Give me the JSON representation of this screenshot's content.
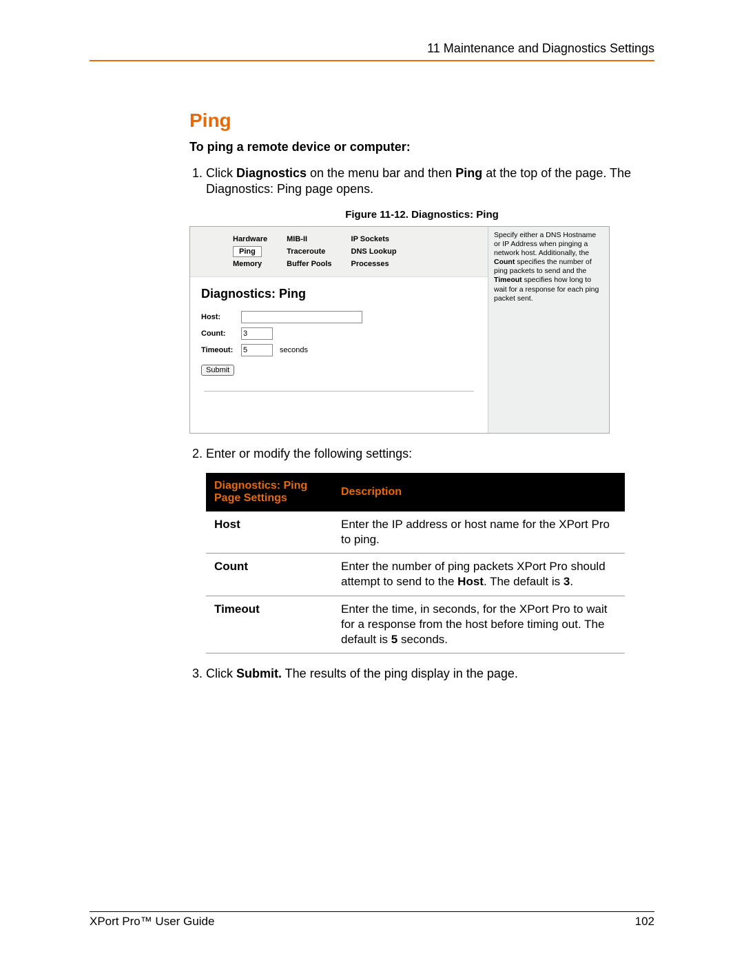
{
  "header": {
    "chapter": "11  Maintenance and Diagnostics Settings"
  },
  "section": {
    "title": "Ping",
    "subtitle": "To ping a remote device or computer:"
  },
  "steps": {
    "s1_pre": "Click ",
    "s1_b1": "Diagnostics",
    "s1_mid": " on the menu bar and then ",
    "s1_b2": "Ping",
    "s1_post": " at the top of the page. The Diagnostics: Ping page opens."
  },
  "figure": {
    "caption": "Figure 11-12. Diagnostics: Ping"
  },
  "screenshot": {
    "tabs": {
      "r1c1": "Hardware",
      "r1c2": "MIB-II",
      "r1c3": "IP Sockets",
      "r2c1": "Ping",
      "r2c2": "Traceroute",
      "r2c3": "DNS Lookup",
      "r3c1": "Memory",
      "r3c2": "Buffer Pools",
      "r3c3": "Processes"
    },
    "panel_title": "Diagnostics: Ping",
    "labels": {
      "host": "Host:",
      "count": "Count:",
      "timeout": "Timeout:"
    },
    "values": {
      "host": "",
      "count": "3",
      "timeout": "5"
    },
    "unit": "seconds",
    "submit": "Submit",
    "help_pre": "Specify either a DNS Hostname or IP Address when pinging a network host. Additionally, the ",
    "help_b1": "Count",
    "help_mid": " specifies the number of ping packets to send and the ",
    "help_b2": "Timeout",
    "help_post": " specifies how long to wait for a response for each ping packet sent."
  },
  "step2": "Enter or modify the following settings:",
  "table": {
    "h1": "Diagnostics: Ping Page Settings",
    "h2": "Description",
    "rows": [
      {
        "k": "Host",
        "v": "Enter the IP address or host name for the XPort Pro to ping."
      },
      {
        "k": "Count",
        "v_pre": "Enter the number of ping packets XPort Pro should attempt to send to the ",
        "v_b1": "Host",
        "v_mid": ". The default is ",
        "v_b2": "3",
        "v_post": "."
      },
      {
        "k": "Timeout",
        "v_pre": "Enter the time, in seconds, for the XPort Pro to wait for a response from the host before timing out. The default is ",
        "v_b1": "5",
        "v_mid": " seconds.",
        "v_b2": "",
        "v_post": ""
      }
    ]
  },
  "step3": {
    "pre": "Click ",
    "b": "Submit.",
    "post": " The results of the ping display in the page."
  },
  "footer": {
    "left": "XPort Pro™ User Guide",
    "right": "102"
  }
}
